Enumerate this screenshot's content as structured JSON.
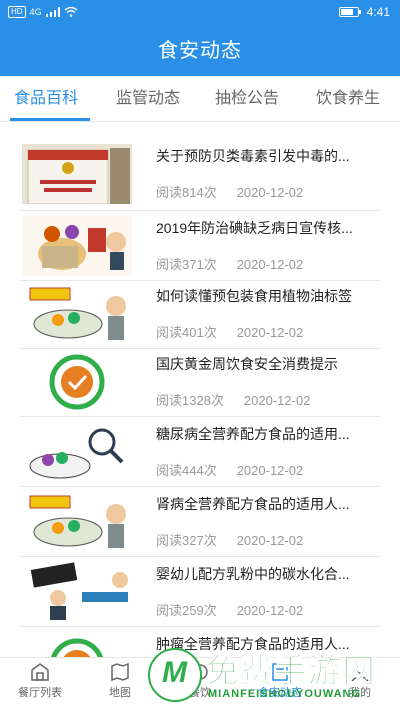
{
  "status_bar": {
    "network": "HD",
    "network2": "4G",
    "time": "4:41"
  },
  "header": {
    "title": "食安动态"
  },
  "tabs": [
    {
      "label": "食品百科",
      "active": true
    },
    {
      "label": "监管动态",
      "active": false
    },
    {
      "label": "抽检公告",
      "active": false
    },
    {
      "label": "饮食养生",
      "active": false
    }
  ],
  "articles": [
    {
      "title": "关于预防贝类毒素引发中毒的...",
      "reads": "阅读814次",
      "date": "2020-12-02",
      "thumb": "law-book"
    },
    {
      "title": "2019年防治碘缺乏病日宣传核...",
      "reads": "阅读371次",
      "date": "2020-12-02",
      "thumb": "food-safety-cartoon"
    },
    {
      "title": "如何读懂预包装食用植物油标签",
      "reads": "阅读401次",
      "date": "2020-12-02",
      "thumb": "safety-first-cartoon"
    },
    {
      "title": "国庆黄金周饮食安全消费提示",
      "reads": "阅读1328次",
      "date": "2020-12-02",
      "thumb": "food-safety-logo"
    },
    {
      "title": "糖尿病全营养配方食品的适用...",
      "reads": "阅读444次",
      "date": "2020-12-02",
      "thumb": "magnifier-cartoon"
    },
    {
      "title": "肾病全营养配方食品的适用人...",
      "reads": "阅读327次",
      "date": "2020-12-02",
      "thumb": "safety-first-cartoon"
    },
    {
      "title": "婴幼儿配方乳粉中的碳水化合...",
      "reads": "阅读259次",
      "date": "2020-12-02",
      "thumb": "blacklist-cartoon"
    },
    {
      "title": "肿瘤全营养配方食品的适用人...",
      "reads": "",
      "date": "",
      "thumb": "food-safety-logo"
    }
  ],
  "bottom_nav": [
    {
      "label": "餐厅列表",
      "icon": "restaurant-icon",
      "active": false
    },
    {
      "label": "地图",
      "icon": "map-icon",
      "active": false
    },
    {
      "label": "餐饮",
      "icon": "dining-icon",
      "active": false
    },
    {
      "label": "食安动态",
      "icon": "news-icon",
      "active": true
    },
    {
      "label": "我的",
      "icon": "user-icon",
      "active": false
    }
  ],
  "watermark": {
    "text": "免费手游网",
    "url": "MIANFEISHOUYOUWANG",
    "logo_letter": "M"
  },
  "colors": {
    "primary": "#2a8fe6",
    "text": "#222222",
    "meta": "#999999",
    "watermark_green": "#1f9a3a"
  }
}
